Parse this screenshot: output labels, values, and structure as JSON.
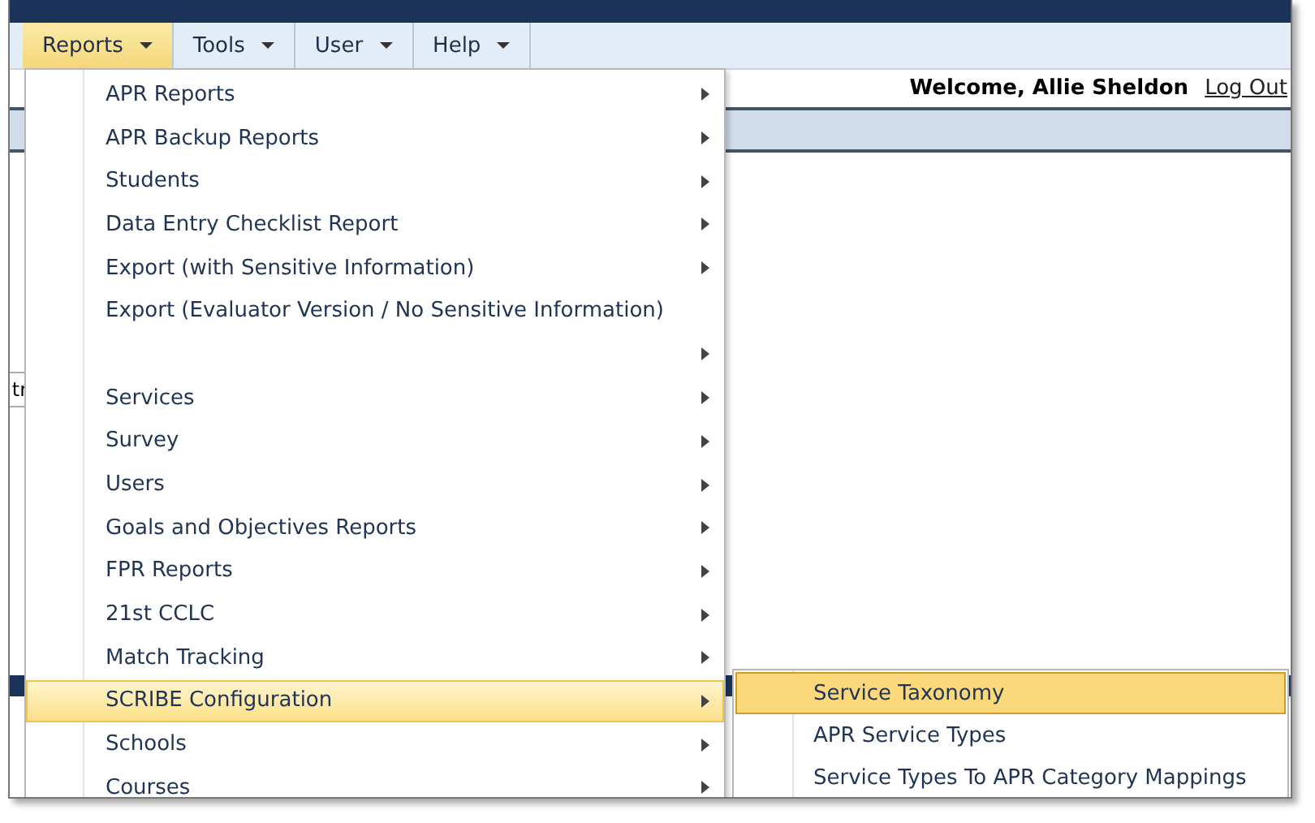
{
  "menubar": [
    {
      "label": "Reports",
      "selected": true
    },
    {
      "label": "Tools",
      "selected": false
    },
    {
      "label": "User",
      "selected": false
    },
    {
      "label": "Help",
      "selected": false
    }
  ],
  "welcome": {
    "text": "Welcome, Allie Sheldon",
    "logout": "Log Out"
  },
  "background_fragment": "tr",
  "menu": [
    {
      "label": "APR Reports",
      "has_submenu": true,
      "selected": false
    },
    {
      "label": "APR Backup Reports",
      "has_submenu": true,
      "selected": false
    },
    {
      "label": "Students",
      "has_submenu": true,
      "selected": false
    },
    {
      "label": "Data Entry Checklist Report",
      "has_submenu": true,
      "selected": false
    },
    {
      "label": "Export (with Sensitive Information)",
      "has_submenu": true,
      "selected": false
    },
    {
      "label": "Export (Evaluator Version / No Sensitive Information)",
      "has_submenu": false,
      "selected": false
    },
    {
      "has_submenu": true,
      "selected": false
    },
    {
      "label": "Services",
      "has_submenu": true,
      "selected": false
    },
    {
      "label": "Survey",
      "has_submenu": true,
      "selected": false
    },
    {
      "label": "Users",
      "has_submenu": true,
      "selected": false
    },
    {
      "label": "Goals and Objectives Reports",
      "has_submenu": true,
      "selected": false
    },
    {
      "label": "FPR Reports",
      "has_submenu": true,
      "selected": false
    },
    {
      "label": "21st CCLC",
      "has_submenu": true,
      "selected": false
    },
    {
      "label": "Match Tracking",
      "has_submenu": true,
      "selected": false
    },
    {
      "label": "SCRIBE Configuration",
      "has_submenu": true,
      "selected": true
    },
    {
      "label": "Schools",
      "has_submenu": true,
      "selected": false
    },
    {
      "label": "Courses",
      "has_submenu": true,
      "selected": false
    }
  ],
  "submenu": [
    {
      "label": "Service Taxonomy",
      "selected": true
    },
    {
      "label": "APR Service Types",
      "selected": false
    },
    {
      "label": "Service Types To APR Category Mappings",
      "selected": false
    }
  ]
}
